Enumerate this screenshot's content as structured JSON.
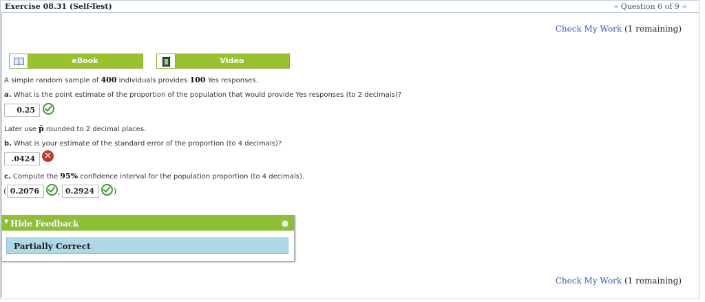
{
  "header": {
    "exercise_title": "Exercise 08.31 (Self-Test)",
    "prev_arrow": "«",
    "question_label": "Question 6 of 9",
    "next_arrow": "»"
  },
  "check_my_work": {
    "link": "Check My Work",
    "remaining": "(1 remaining)"
  },
  "media_buttons": {
    "ebook": "eBook",
    "video": "Video"
  },
  "problem": {
    "intro_prefix": "A simple random sample of ",
    "n": "400",
    "intro_middle": " individuals provides ",
    "yes_count": "100",
    "intro_suffix": " Yes responses.",
    "a_label": "a.",
    "a_text": " What is the point estimate of the proportion of the population that would provide Yes responses (to 2 decimals)?",
    "a_answer": "0.25",
    "note_prefix": "Later use ",
    "note_symbol": "p̄",
    "note_suffix": " rounded to 2 decimal places.",
    "b_label": "b.",
    "b_text": " What is your estimate of the standard error of the proportion (to 4 decimals)?",
    "b_answer": ".0424",
    "c_label": "c.",
    "c_text_prefix": " Compute the ",
    "c_conf": "95%",
    "c_text_suffix": " confidence interval for the population proportion (to 4 decimals).",
    "c_lower": "0.2076",
    "c_upper": "0.2924",
    "open_paren": "(",
    "comma": ",",
    "close_paren": ")"
  },
  "feedback": {
    "arrow": "▼",
    "toggle_label": "Hide Feedback",
    "status": "Partially Correct"
  },
  "colors": {
    "accent_green": "#99c230",
    "link_blue": "#2a5db0",
    "correct_green": "#3c9a2e",
    "wrong_red": "#c0392b",
    "feedback_blue": "#add8e6"
  },
  "icons": {
    "ebook": "book-icon",
    "video": "film-icon",
    "correct": "check-circle-icon",
    "incorrect": "x-circle-icon",
    "collapse": "collapse-icon"
  }
}
